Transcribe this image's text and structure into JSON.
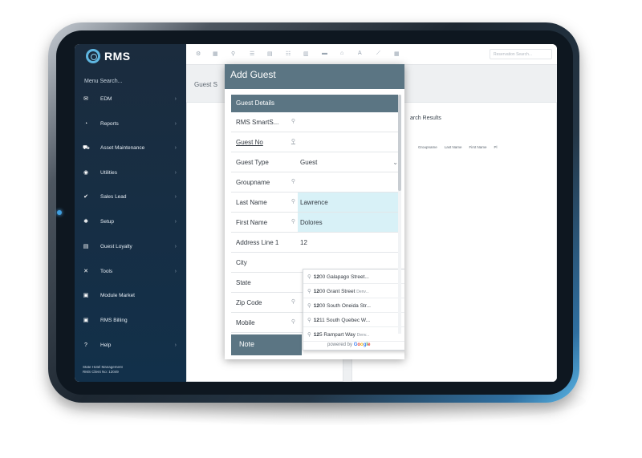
{
  "app": {
    "logo_text": "RMS"
  },
  "sidebar": {
    "menu_search": "Menu Search...",
    "items": [
      {
        "label": "EDM",
        "icon": "envelope-icon",
        "glyph": "✉"
      },
      {
        "label": "Reports",
        "icon": "pie-chart-icon",
        "glyph": "◔"
      },
      {
        "label": "Asset Maintenance",
        "icon": "car-icon",
        "glyph": "🚗"
      },
      {
        "label": "Utilities",
        "icon": "gauge-icon",
        "glyph": "◉"
      },
      {
        "label": "Sales Lead",
        "icon": "check-circle-icon",
        "glyph": "✔"
      },
      {
        "label": "Setup",
        "icon": "gear-icon",
        "glyph": "✱"
      },
      {
        "label": "Guest Loyalty",
        "icon": "id-card-icon",
        "glyph": "▤"
      },
      {
        "label": "Tools",
        "icon": "tools-icon",
        "glyph": "✕"
      },
      {
        "label": "Module Market",
        "icon": "plus-square-icon",
        "glyph": "▣"
      },
      {
        "label": "RMS Billing",
        "icon": "plus-square-icon",
        "glyph": "▣"
      },
      {
        "label": "Help",
        "icon": "question-circle-icon",
        "glyph": "❓"
      }
    ],
    "footer_line1": "State Hotel Management",
    "footer_line2": "RMS Client No: 12049"
  },
  "topbar": {
    "reservation_search_placeholder": "Reservation Search..."
  },
  "background": {
    "page_title": "Guest S",
    "search_results_title": "arch Results",
    "results_columns": [
      "Groupname",
      "Last Name",
      "First Name",
      "Pl"
    ]
  },
  "modal": {
    "title": "Add Guest",
    "section_title": "Guest Details",
    "fields": [
      {
        "label": "RMS SmartS...",
        "value": "",
        "lookup": true
      },
      {
        "label": "Guest No",
        "value": "",
        "lookup": true
      },
      {
        "label": "Guest Type",
        "value": "Guest",
        "lookup": false
      },
      {
        "label": "Groupname",
        "value": "",
        "lookup": true
      },
      {
        "label": "Last Name",
        "value": "Lawrence",
        "lookup": true
      },
      {
        "label": "First Name",
        "value": "Dolores",
        "lookup": true
      },
      {
        "label": "Address Line 1",
        "value": "12",
        "lookup": false
      },
      {
        "label": "City",
        "value": "",
        "lookup": false
      },
      {
        "label": "State",
        "value": "",
        "lookup": false
      },
      {
        "label": "Zip Code",
        "value": "",
        "lookup": true
      },
      {
        "label": "Mobile",
        "value": "",
        "lookup": true
      }
    ],
    "note_button": "Note"
  },
  "autocomplete": {
    "items": [
      {
        "bold": "12",
        "rest": "00 Galapago Street...",
        "sub": ""
      },
      {
        "bold": "12",
        "rest": "00 Grant Street ",
        "sub": "Denv..."
      },
      {
        "bold": "12",
        "rest": "00 South Oneida Str...",
        "sub": ""
      },
      {
        "bold": "12",
        "rest": "11 South Quebec W...",
        "sub": ""
      },
      {
        "bold": "12",
        "rest": "5 Rampart Way ",
        "sub": "Denv..."
      }
    ],
    "powered_by": "powered by",
    "google": [
      "G",
      "o",
      "o",
      "g",
      "l",
      "e"
    ]
  },
  "colors": {
    "modal_header": "#5b7583",
    "highlight": "#d8f1f7",
    "sidebar": "#1b2c3e"
  }
}
